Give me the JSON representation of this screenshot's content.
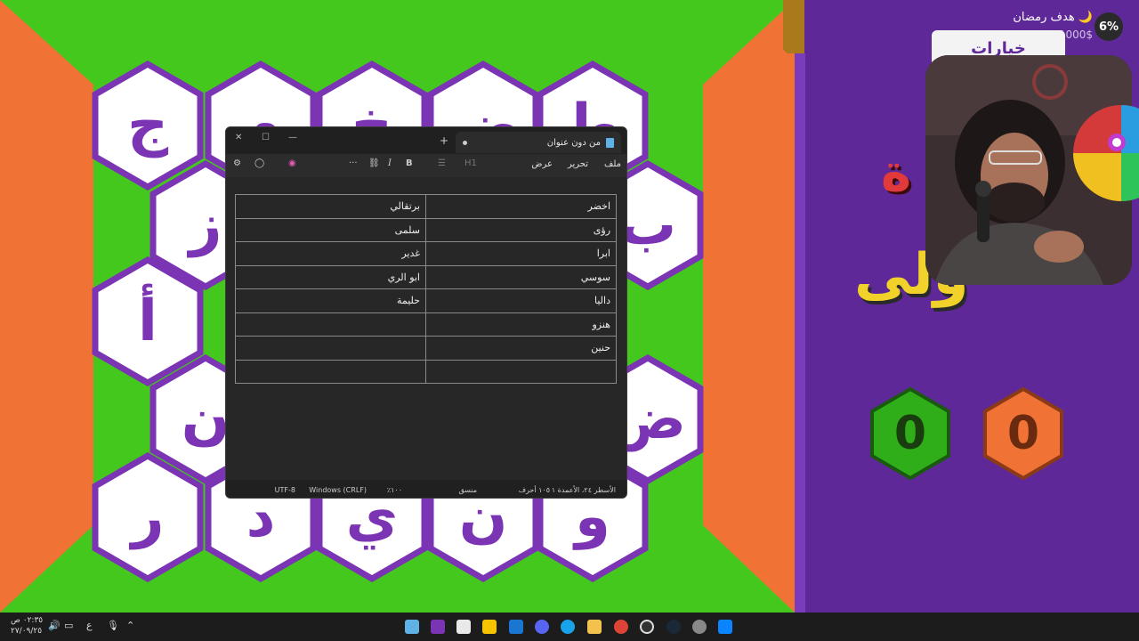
{
  "colors": {
    "green": "#44c81d",
    "orange": "#f07335",
    "purple": "#5f2898",
    "hex_border": "#7b34b3"
  },
  "board": {
    "tiles": [
      "ج",
      "م",
      "خ",
      "ض",
      "ط",
      "ز",
      "ب",
      "أ",
      "ن",
      "ض",
      "ر",
      "د",
      "ي",
      "ن",
      "و"
    ]
  },
  "stream": {
    "goal_title": "هدف رمضان 🌙",
    "goal_amount": "55/1000$",
    "goal_percent": "6%",
    "choices_label": "خيارات",
    "side_letter_1": "ة",
    "side_letter_2": "ولى",
    "score_green": "0",
    "score_orange": "0"
  },
  "notepad": {
    "tab_title": "من دون عنوان",
    "menu": {
      "file": "ملف",
      "edit": "تحرير",
      "view": "عرض"
    },
    "toolbar": {
      "heading": "H1",
      "bold": "B",
      "italic": "I",
      "more": "···"
    },
    "table": [
      [
        "اخضر",
        "برتقالي"
      ],
      [
        "رؤى",
        "سلمى"
      ],
      [
        "ابرا",
        "غدير"
      ],
      [
        "سوسي",
        "ابو الري"
      ],
      [
        "داليا",
        "حليمة"
      ],
      [
        "هنزو",
        ""
      ],
      [
        "حنين",
        ""
      ],
      [
        "",
        ""
      ]
    ],
    "status": {
      "position": "الأسطر ٢٤، الأعمدة ١",
      "chars": "١٠٥ أحرف",
      "format": "منسق",
      "zoom": "١٠٠٪",
      "line_ending": "Windows (CRLF)",
      "encoding": "UTF-8"
    }
  },
  "taskbar": {
    "time": "٠٢:٣٥ ص",
    "date": "٢٧/٠٩/٢٥",
    "lang": "ع"
  }
}
